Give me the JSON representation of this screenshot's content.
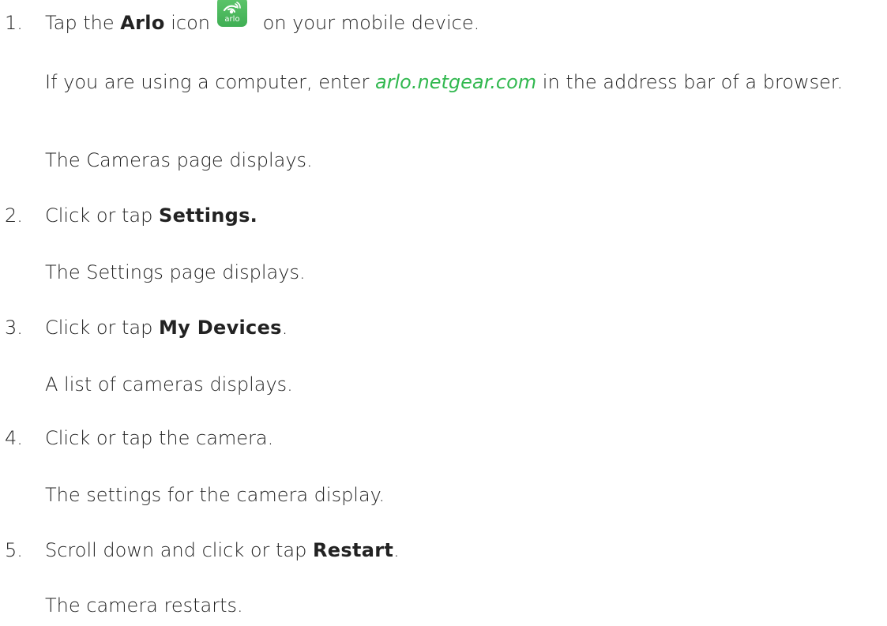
{
  "colors": {
    "text": "#222222",
    "link": "#31b84f",
    "icon_bg": "#4cb85c"
  },
  "steps": [
    {
      "number": "1.",
      "pre": "Tap the ",
      "bold": "Arlo",
      "mid": " icon",
      "icon": "arlo-app-icon",
      "icon_text": "arlo",
      "post": " on your mobile device.",
      "note_pre": "If you are using a computer, enter ",
      "note_link": "arlo.netgear.com",
      "note_post": " in the address bar of a browser.",
      "result": "The Cameras page displays."
    },
    {
      "number": "2.",
      "pre": "Click or tap ",
      "bold": "Settings.",
      "result": "The Settings page displays."
    },
    {
      "number": "3.",
      "pre": "Click or tap ",
      "bold": "My Devices",
      "post": ".",
      "result": "A list of cameras displays."
    },
    {
      "number": "4.",
      "pre": "Click or tap the camera.",
      "result": "The settings for the camera display."
    },
    {
      "number": "5.",
      "pre": "Scroll down and click or tap ",
      "bold": "Restart",
      "post": ".",
      "result": "The camera restarts."
    }
  ]
}
